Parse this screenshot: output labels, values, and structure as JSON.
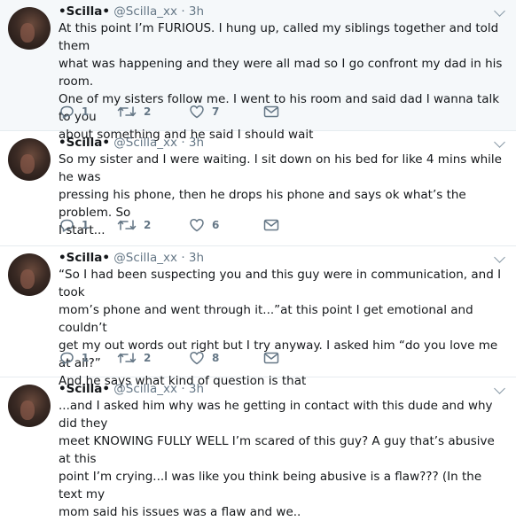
{
  "tweets": [
    {
      "name": "•Scilla•",
      "handle": "@Scilla_xx",
      "separator": "·",
      "time": "3h",
      "text": "At this point I’m FURIOUS. I hung up, called my siblings together and told them\nwhat was happening and they were all mad so I go confront my dad in his room.\nOne of my sisters follow me. I went to his room and said dad I wanna talk to you\nabout something and he said I should wait",
      "replies": "1",
      "retweets": "2",
      "likes": "7"
    },
    {
      "name": "•Scilla•",
      "handle": "@Scilla_xx",
      "separator": "·",
      "time": "3h",
      "text": "So my sister and I were waiting. I sit down on his bed for like 4 mins while he was\npressing his phone, then he drops his phone and says ok what’s the problem. So\nI start...",
      "replies": "1",
      "retweets": "2",
      "likes": "6"
    },
    {
      "name": "•Scilla•",
      "handle": "@Scilla_xx",
      "separator": "·",
      "time": "3h",
      "text": "“So I had been suspecting you and this guy were in communication, and I took\nmom’s phone and went through it...”at this point I get emotional and couldn’t\nget my out words out right but I try anyway. I asked him “do you love me at all?”\nAnd he says what kind of question is that",
      "replies": "1",
      "retweets": "2",
      "likes": "8"
    },
    {
      "name": "•Scilla•",
      "handle": "@Scilla_xx",
      "separator": "·",
      "time": "3h",
      "text": "...and I asked him why was he getting in contact with this dude and why did they\nmeet KNOWING FULLY WELL I’m scared of this guy? A guy that’s abusive at this\npoint I’m crying...I was like you think being abusive is a flaw??? (In the text my\nmom said his issues was a flaw and we..",
      "replies": "",
      "retweets": "",
      "likes": ""
    }
  ]
}
